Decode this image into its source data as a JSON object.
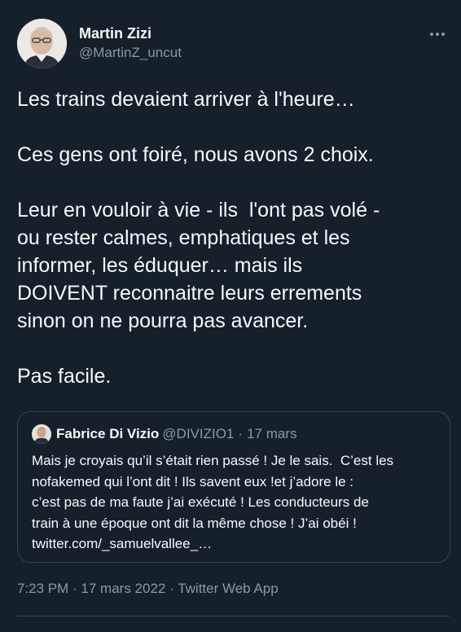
{
  "author": {
    "name": "Martin Zizi",
    "handle": "@MartinZ_uncut"
  },
  "tweet": {
    "lines": [
      "Les trains devaient arriver à l'heure…",
      "",
      "Ces gens ont foiré, nous avons 2 choix.",
      "",
      "Leur en vouloir à vie - ils  l'ont pas volé -",
      "ou rester calmes, emphatiques et les",
      "informer, les éduquer… mais ils",
      "DOIVENT reconnaitre leurs errements",
      "sinon on ne pourra pas avancer.",
      "",
      "Pas facile."
    ]
  },
  "quote": {
    "name": "Fabrice Di Vizio",
    "handle": "@DIVIZIO1",
    "separator": "·",
    "date": "17 mars",
    "lines": [
      "Mais je croyais qu’il s’était rien passé ! Je le sais.  C’est les",
      "nofakemed qui l’ont dit ! Ils savent eux !et j’adore le :",
      "c’est pas de ma faute j’ai exécuté ! Les conducteurs de",
      "train à une époque ont dit la même chose ! J’ai obéi !",
      "twitter.com/_samuelvallee_…"
    ]
  },
  "meta": {
    "time": "7:23 PM",
    "separator": " · ",
    "date": "17 mars 2022",
    "source": "Twitter Web App"
  },
  "colors": {
    "background": "#15202b",
    "text": "#f7f9f9",
    "secondary": "#8b98a5",
    "border": "#38444d"
  },
  "icons": {
    "more": "more-horizontal-icon"
  }
}
